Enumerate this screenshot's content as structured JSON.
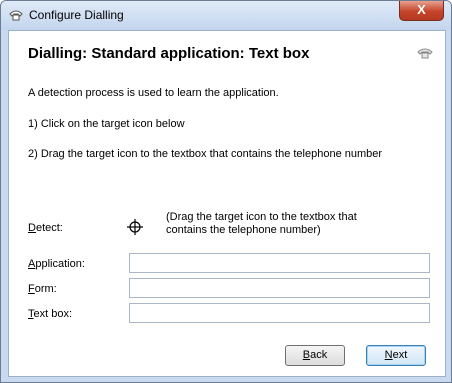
{
  "window": {
    "title": "Configure Dialling",
    "close_label": "X"
  },
  "header": {
    "title": "Dialling: Standard application: Text box"
  },
  "instructions": {
    "intro": "A detection process is used to learn the application.",
    "step1": "1) Click on the target icon below",
    "step2": "2) Drag the target icon to the textbox that contains the telephone number"
  },
  "detect": {
    "label_first": "D",
    "label_rest": "etect:",
    "note": "(Drag the target icon to the textbox that contains the telephone number)"
  },
  "fields": {
    "application": {
      "label_first": "A",
      "label_rest": "pplication:",
      "value": ""
    },
    "form": {
      "label_first": "F",
      "label_rest": "orm:",
      "value": ""
    },
    "textbox": {
      "label_first": "T",
      "label_rest": "ext box:",
      "value": ""
    }
  },
  "buttons": {
    "back": {
      "first": "B",
      "rest": "ack"
    },
    "next": {
      "first": "N",
      "rest": "ext"
    }
  },
  "colors": {
    "close_button": "#c4442a",
    "default_button_border": "#3c7fb1"
  }
}
